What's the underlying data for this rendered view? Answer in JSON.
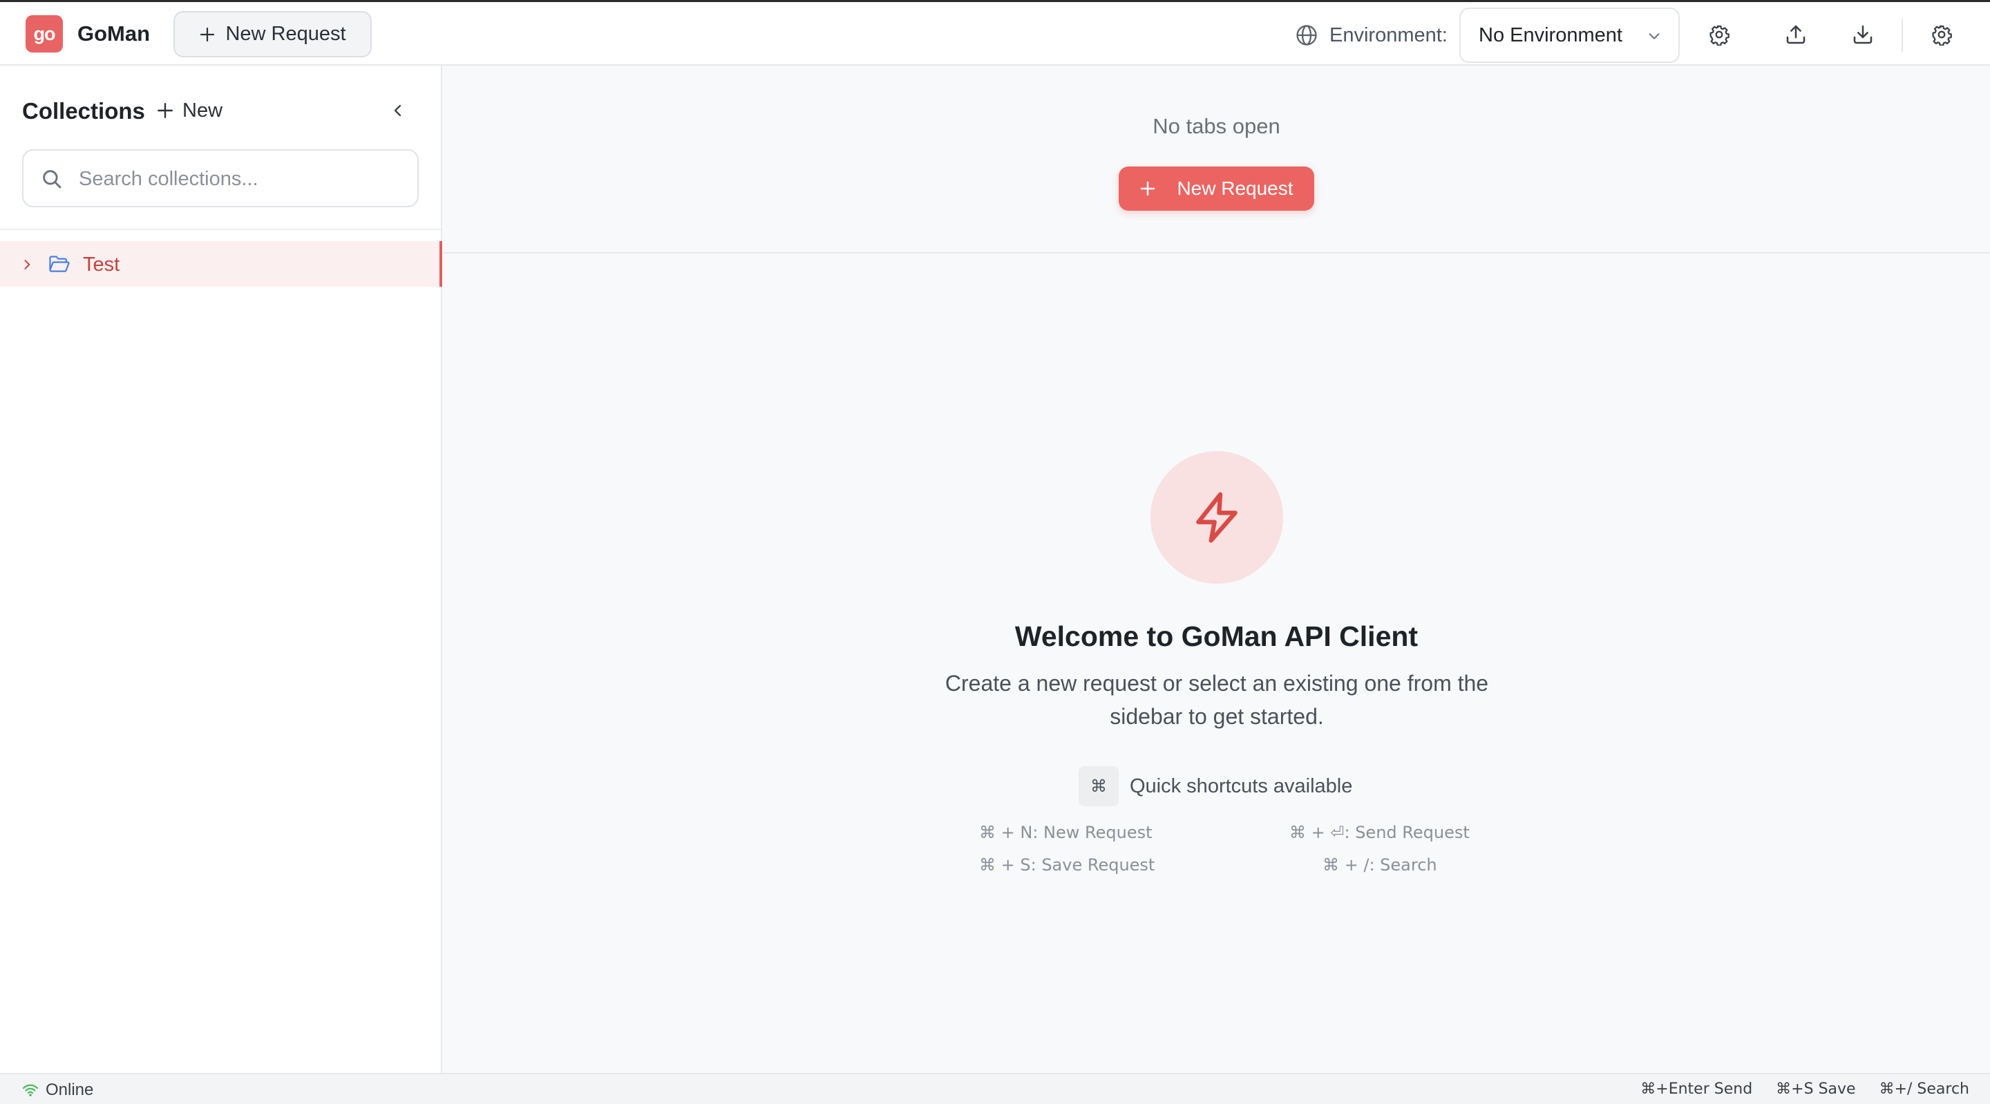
{
  "colors": {
    "brand": "#e86363",
    "primary_button": "#ec6461",
    "selected_item_bg": "#fcefef",
    "selected_item_text": "#c0443f",
    "folder_icon": "#4a7fe0",
    "online_icon": "#3fb950"
  },
  "header": {
    "logo_text": "go",
    "app_name": "GoMan",
    "new_request_label": "New Request",
    "environment_label": "Environment:",
    "environment_value": "No Environment",
    "icons": [
      "globe-icon",
      "gear-icon",
      "upload-icon",
      "download-icon",
      "settings-icon"
    ]
  },
  "sidebar": {
    "title": "Collections",
    "new_label": "New",
    "search_placeholder": "Search collections...",
    "collections": [
      {
        "label": "Test",
        "expanded": false,
        "selected": true
      }
    ]
  },
  "main": {
    "no_tabs_text": "No tabs open",
    "new_request_label": "New Request",
    "welcome_title": "Welcome to GoMan API Client",
    "welcome_line1": "Create a new request or select an existing one from the",
    "welcome_line2": "sidebar to get started.",
    "shortcut_key_glyph": "⌘",
    "shortcut_hint": "Quick shortcuts available",
    "shortcuts": [
      "⌘ + N: New Request",
      "⌘ + ⏎: Send Request",
      "⌘ + S: Save Request",
      "⌘ + /: Search"
    ]
  },
  "statusbar": {
    "status": "Online",
    "shortcuts": [
      "⌘+Enter Send",
      "⌘+S Save",
      "⌘+/ Search"
    ]
  }
}
